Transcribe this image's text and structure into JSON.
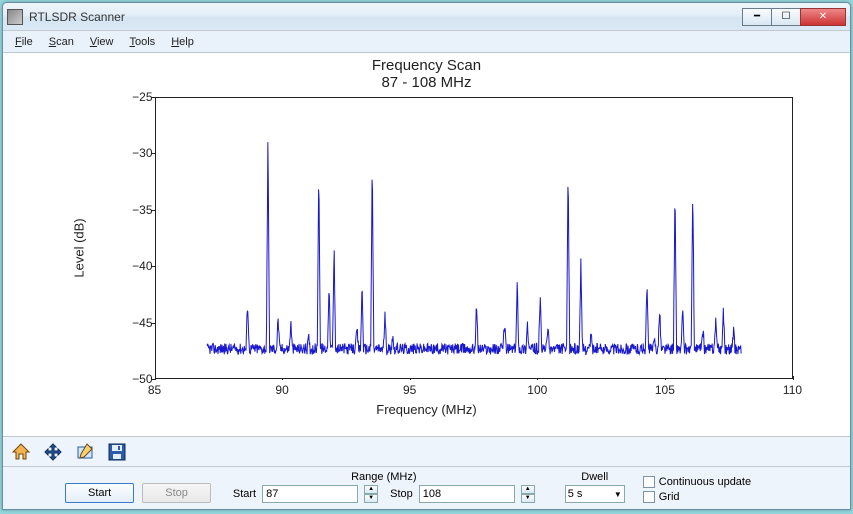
{
  "window": {
    "title": "RTLSDR Scanner"
  },
  "menu": {
    "file": "File",
    "scan": "Scan",
    "view": "View",
    "tools": "Tools",
    "help": "Help"
  },
  "chart_data": {
    "type": "line",
    "title": "Frequency Scan",
    "subtitle": "87 - 108 MHz",
    "xlabel": "Frequency (MHz)",
    "ylabel": "Level (dB)",
    "xlim": [
      85,
      110
    ],
    "ylim": [
      -50,
      -25
    ],
    "x_ticks": [
      85,
      90,
      95,
      100,
      105,
      110
    ],
    "y_ticks": [
      -25,
      -30,
      -35,
      -40,
      -45,
      -50
    ],
    "baseline": -47.4,
    "noise_amplitude": 0.5,
    "x_data_range": [
      87,
      108
    ],
    "peaks": [
      {
        "x": 88.6,
        "y": -43.0
      },
      {
        "x": 89.4,
        "y": -28.1
      },
      {
        "x": 89.8,
        "y": -44.6
      },
      {
        "x": 90.3,
        "y": -44.9
      },
      {
        "x": 91.0,
        "y": -46.4
      },
      {
        "x": 91.4,
        "y": -30.9
      },
      {
        "x": 91.8,
        "y": -41.5
      },
      {
        "x": 92.0,
        "y": -38.2
      },
      {
        "x": 92.9,
        "y": -45.6
      },
      {
        "x": 93.1,
        "y": -41.6
      },
      {
        "x": 93.5,
        "y": -30.4
      },
      {
        "x": 94.0,
        "y": -44.4
      },
      {
        "x": 94.3,
        "y": -46.2
      },
      {
        "x": 97.6,
        "y": -43.4
      },
      {
        "x": 98.7,
        "y": -44.9
      },
      {
        "x": 99.2,
        "y": -41.5
      },
      {
        "x": 99.6,
        "y": -45.1
      },
      {
        "x": 100.1,
        "y": -42.6
      },
      {
        "x": 100.4,
        "y": -45.3
      },
      {
        "x": 101.2,
        "y": -31.4
      },
      {
        "x": 101.7,
        "y": -39.8
      },
      {
        "x": 102.1,
        "y": -46.0
      },
      {
        "x": 104.3,
        "y": -41.5
      },
      {
        "x": 104.6,
        "y": -46.6
      },
      {
        "x": 104.8,
        "y": -43.9
      },
      {
        "x": 105.4,
        "y": -33.1
      },
      {
        "x": 105.7,
        "y": -43.7
      },
      {
        "x": 106.1,
        "y": -32.7
      },
      {
        "x": 106.5,
        "y": -45.7
      },
      {
        "x": 107.0,
        "y": -44.6
      },
      {
        "x": 107.3,
        "y": -43.9
      },
      {
        "x": 107.7,
        "y": -45.8
      }
    ]
  },
  "toolbar": {
    "start": "Start",
    "stop": "Stop"
  },
  "range": {
    "header": "Range (MHz)",
    "start_label": "Start",
    "start_value": "87",
    "stop_label": "Stop",
    "stop_value": "108"
  },
  "dwell": {
    "header": "Dwell",
    "value": "5 s"
  },
  "options": {
    "continuous": "Continuous update",
    "grid": "Grid"
  }
}
